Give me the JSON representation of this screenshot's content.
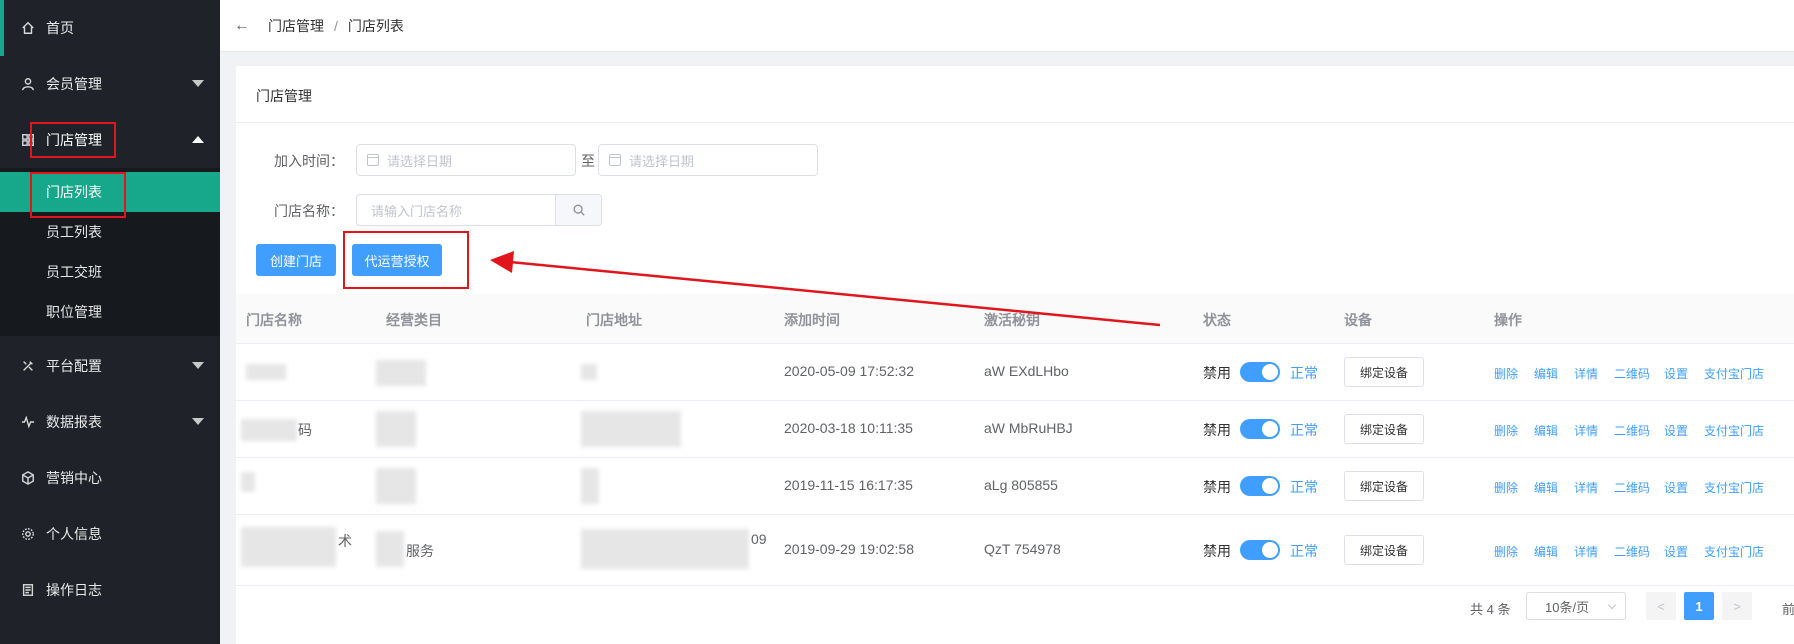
{
  "sidebar": {
    "items": [
      {
        "label": "首页",
        "icon": "home-icon"
      },
      {
        "label": "会员管理",
        "icon": "user-icon"
      },
      {
        "label": "门店管理",
        "icon": "grid-icon"
      },
      {
        "label": "平台配置",
        "icon": "tools-icon"
      },
      {
        "label": "数据报表",
        "icon": "pulse-icon"
      },
      {
        "label": "营销中心",
        "icon": "cube-icon"
      },
      {
        "label": "个人信息",
        "icon": "gear-icon"
      },
      {
        "label": "操作日志",
        "icon": "document-icon"
      }
    ],
    "submenu": [
      "门店列表",
      "员工列表",
      "员工交班",
      "职位管理"
    ],
    "accent_color": "#17a88b"
  },
  "breadcrumb": {
    "first": "门店管理",
    "separator": "/",
    "second": "门店列表"
  },
  "card": {
    "title": "门店管理"
  },
  "filters": {
    "join_time_label": "加入时间：",
    "date_placeholder": "请选择日期",
    "to_label": "至",
    "name_label": "门店名称：",
    "name_placeholder": "请输入门店名称"
  },
  "actions": {
    "create": "创建门店",
    "authorize": "代运营授权"
  },
  "table": {
    "headers": [
      "门店名称",
      "经营类目",
      "门店地址",
      "添加时间",
      "激活秘钥",
      "状态",
      "设备",
      "操作"
    ],
    "rows": [
      {
        "name": "",
        "category": "",
        "address": "",
        "time": "2020-05-09 17:52:32",
        "key": "aW EXdLHbo"
      },
      {
        "name": "码",
        "category": "",
        "address": "",
        "time": "2020-03-18 10:11:35",
        "key": "aW MbRuHBJ"
      },
      {
        "name": "",
        "category": "",
        "address": "",
        "time": "2019-11-15 16:17:35",
        "key": "aLg 805855"
      },
      {
        "name": "术",
        "category": "服务",
        "address": "09",
        "time": "2019-09-29 19:02:58",
        "key": "QzT 754978"
      }
    ],
    "status_disabled": "禁用",
    "status_enabled": "正常",
    "bind_label": "绑定设备",
    "ops": [
      "删除",
      "编辑",
      "详情",
      "二维码",
      "设置",
      "支付宝门店"
    ]
  },
  "pagination": {
    "total": "共 4 条",
    "page_size": "10条/页",
    "prev": "<",
    "current": "1",
    "next": ">",
    "goto": "前"
  },
  "colors": {
    "primary": "#409eff",
    "annotation": "#e0161c"
  }
}
